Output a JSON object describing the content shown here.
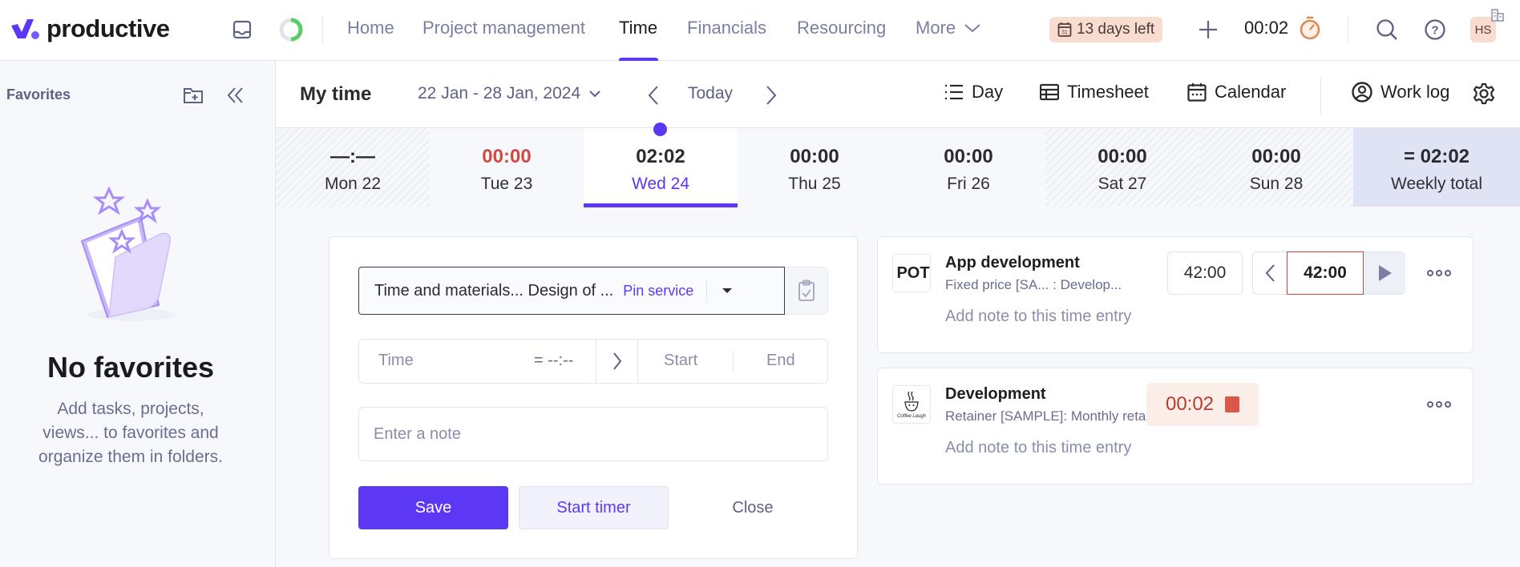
{
  "app": {
    "brand": "productive",
    "brand_color": "#5c38f5"
  },
  "topnav": {
    "items": [
      {
        "label": "Home",
        "active": false
      },
      {
        "label": "Project management",
        "active": false
      },
      {
        "label": "Time",
        "active": true
      },
      {
        "label": "Financials",
        "active": false
      },
      {
        "label": "Resourcing",
        "active": false
      },
      {
        "label": "More",
        "active": false
      }
    ],
    "trial_badge": "13 days left",
    "running_timer": "00:02",
    "user_initials": "HS",
    "icons": [
      "inbox-icon",
      "progress-ring-icon",
      "calendar-icon",
      "plus-icon",
      "stopwatch-icon",
      "search-icon",
      "help-icon",
      "building-icon"
    ]
  },
  "sidebar": {
    "title": "Favorites",
    "empty_title": "No favorites",
    "empty_description": "Add tasks, projects, views... to favorites and organize them in folders."
  },
  "toolbar": {
    "title": "My time",
    "date_range": "22 Jan - 28 Jan, 2024",
    "today_label": "Today",
    "views": [
      {
        "label": "Day",
        "icon": "list-icon"
      },
      {
        "label": "Timesheet",
        "icon": "table-icon"
      },
      {
        "label": "Calendar",
        "icon": "calendar-icon"
      }
    ],
    "work_log_label": "Work log"
  },
  "week": {
    "days": [
      {
        "time": "—:—",
        "label": "Mon 22",
        "style": "hatched"
      },
      {
        "time": "00:00",
        "label": "Tue 23",
        "style": "missing"
      },
      {
        "time": "02:02",
        "label": "Wed 24",
        "style": "selected"
      },
      {
        "time": "00:00",
        "label": "Thu 25",
        "style": "normal"
      },
      {
        "time": "00:00",
        "label": "Fri 26",
        "style": "normal"
      },
      {
        "time": "00:00",
        "label": "Sat 27",
        "style": "hatched"
      },
      {
        "time": "00:00",
        "label": "Sun 28",
        "style": "hatched"
      }
    ],
    "total": {
      "time": "= 02:02",
      "label": "Weekly total"
    }
  },
  "form": {
    "service_value": "Time and materials... Design of ...",
    "pin_service_label": "Pin service",
    "time_placeholder": "Time",
    "time_computed": "= --:--",
    "start_placeholder": "Start",
    "end_placeholder": "End",
    "note_placeholder": "Enter a note",
    "save_label": "Save",
    "start_timer_label": "Start timer",
    "close_label": "Close"
  },
  "entries": [
    {
      "logo_text": "POT",
      "title": "App development",
      "subtitle": "Fixed price [SA...  : Develop...",
      "note_placeholder": "Add note to this time entry",
      "estimate": "42:00",
      "duration": "42:00",
      "state": "stopped"
    },
    {
      "logo_text": "Coffee Laugh",
      "title": "Development",
      "subtitle": "Retainer [SAMPLE]: Monthly retainer",
      "note_placeholder": "Add note to this time entry",
      "duration": "00:02",
      "state": "running"
    }
  ]
}
